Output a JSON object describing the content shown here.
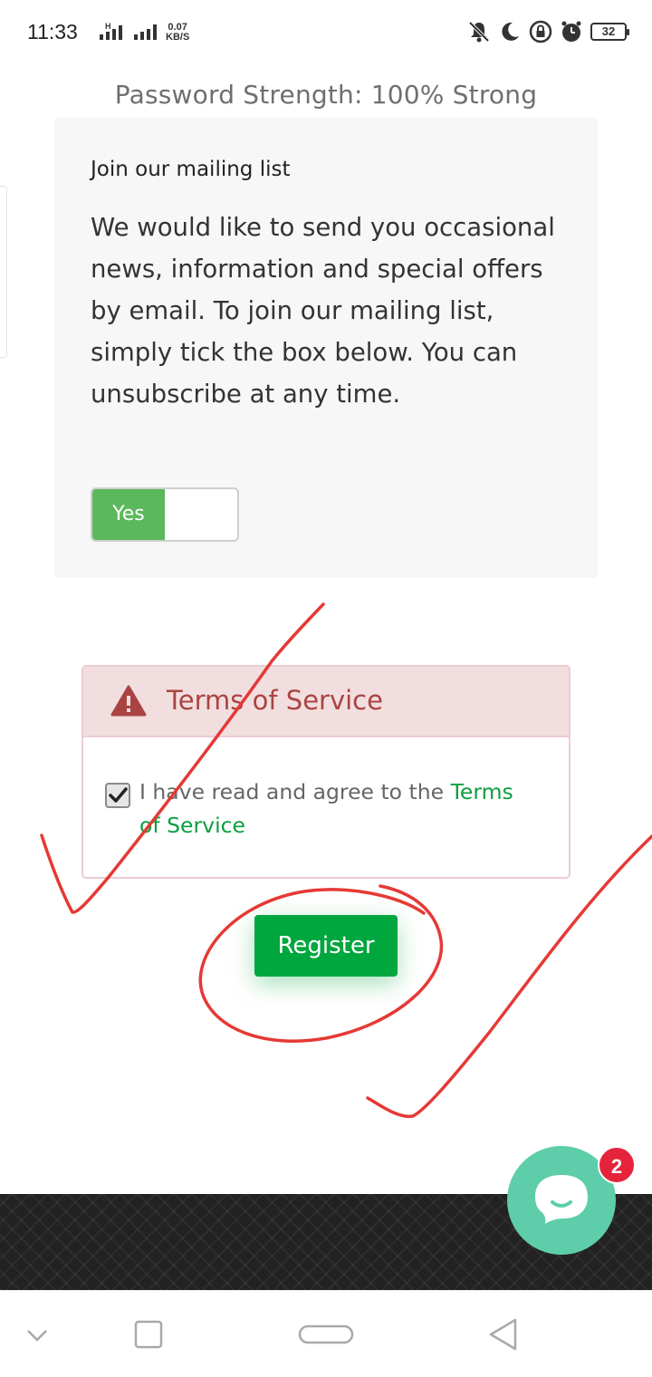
{
  "status_bar": {
    "time": "11:33",
    "network_speed_value": "0.07",
    "network_speed_unit": "KB/S",
    "network_type": "H",
    "battery": "32",
    "icons": [
      "mute-icon",
      "moon-icon",
      "lock-rotation-icon",
      "alarm-icon"
    ]
  },
  "password_strength": "Password Strength: 100% Strong",
  "mailing": {
    "title": "Join our mailing list",
    "body": "We would like to send you occasional news, information and special offers by email. To join our mailing list, simply tick the box below. You can unsubscribe at any time.",
    "toggle_label": "Yes",
    "toggle_on": true
  },
  "terms": {
    "title": "Terms of Service",
    "agree_text": "I have read and agree to the ",
    "link_text": "Terms of Service",
    "checked": true
  },
  "register_label": "Register",
  "chat": {
    "badge_count": "2"
  },
  "colors": {
    "accent_green": "#00a63e",
    "toggle_green": "#5cb85c",
    "danger_red": "#a94442",
    "chat_teal": "#5ecda9",
    "badge_red": "#e5243b",
    "annotation_red": "#e53935"
  },
  "nav": [
    "chevron-down-icon",
    "recents-icon",
    "home-pill-icon",
    "back-icon"
  ]
}
